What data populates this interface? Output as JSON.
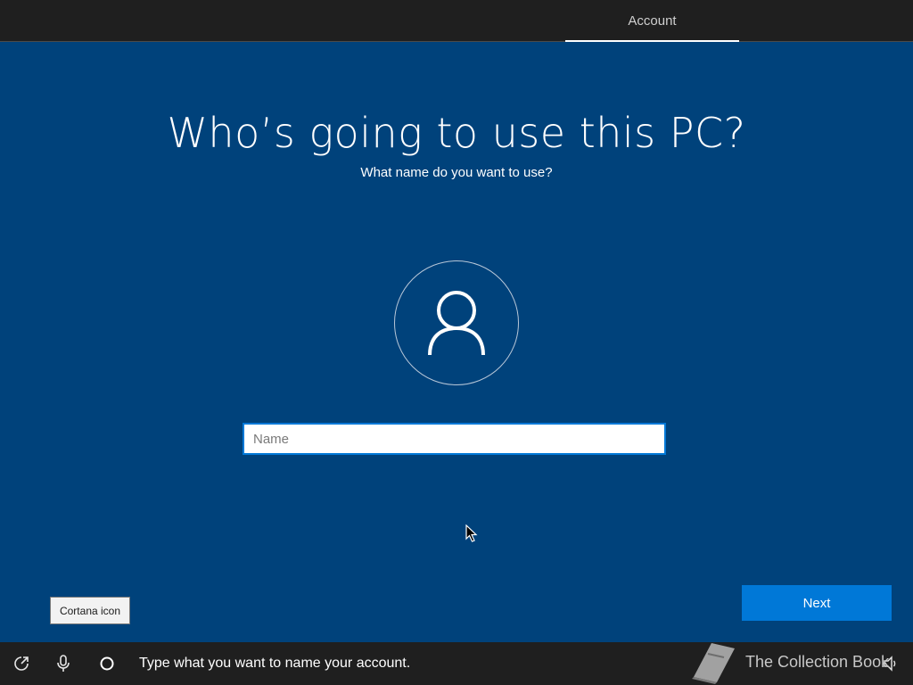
{
  "header": {
    "tabs": [
      {
        "label": "Account",
        "active": true
      }
    ]
  },
  "main": {
    "title": "Who’s going to use this PC?",
    "subtitle": "What name do you want to use?",
    "name_input": {
      "value": "",
      "placeholder": "Name"
    },
    "next_label": "Next"
  },
  "tooltip": {
    "text": "Cortana icon"
  },
  "bottombar": {
    "icons": [
      "accessibility-icon",
      "microphone-icon",
      "cortana-icon",
      "volume-icon"
    ],
    "status_text": "Type what you want to name your account."
  },
  "watermark": {
    "text": "The Collection Book"
  },
  "colors": {
    "background": "#00427b",
    "bars": "#1f1f1f",
    "accent": "#0078d7"
  }
}
